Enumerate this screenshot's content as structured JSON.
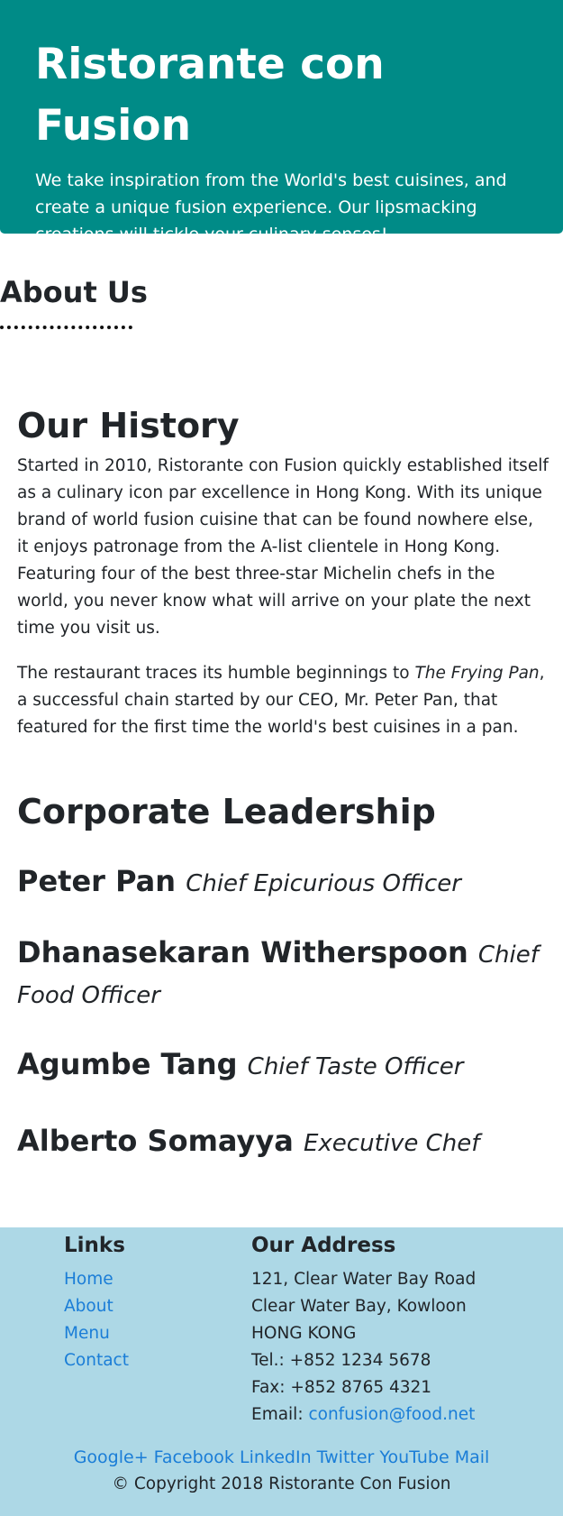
{
  "header": {
    "title": "Ristorante con Fusion",
    "tagline": "We take inspiration from the World's best cuisines, and create a unique fusion experience. Our lipsmacking creations will tickle your culinary senses!"
  },
  "about": {
    "title": "About Us"
  },
  "history": {
    "title": "Our History",
    "p1": "Started in 2010, Ristorante con Fusion quickly established itself as a culinary icon par excellence in Hong Kong. With its unique brand of world fusion cuisine that can be found nowhere else, it enjoys patronage from the A-list clientele in Hong Kong. Featuring four of the best three-star Michelin chefs in the world, you never know what will arrive on your plate the next time you visit us.",
    "p2_before": "The restaurant traces its humble beginnings to ",
    "p2_italic": "The Frying Pan",
    "p2_after": ", a successful chain started by our CEO, Mr. Peter Pan, that featured for the first time the world's best cuisines in a pan."
  },
  "leadership": {
    "title": "Corporate Leadership",
    "leaders": [
      {
        "name": "Peter Pan",
        "role": "Chief Epicurious Officer"
      },
      {
        "name": "Dhanasekaran Witherspoon",
        "role": "Chief Food Officer"
      },
      {
        "name": "Agumbe Tang",
        "role": "Chief Taste Officer"
      },
      {
        "name": "Alberto Somayya",
        "role": "Executive Chef"
      }
    ]
  },
  "footer": {
    "links_title": "Links",
    "links": [
      "Home",
      "About",
      "Menu",
      "Contact"
    ],
    "address_title": "Our Address",
    "address_lines": [
      "121, Clear Water Bay Road",
      "Clear Water Bay, Kowloon",
      "HONG KONG",
      "Tel.: +852 1234 5678",
      "Fax: +852 8765 4321"
    ],
    "email_label": "Email: ",
    "email": "confusion@food.net",
    "social": [
      "Google+",
      "Facebook",
      "LinkedIn",
      "Twitter",
      "YouTube",
      "Mail"
    ],
    "copyright": "© Copyright 2018 Ristorante Con Fusion"
  },
  "colors": {
    "header_bg": "#008b87",
    "footer_bg": "#add8e6",
    "link": "#1a7dd7"
  }
}
